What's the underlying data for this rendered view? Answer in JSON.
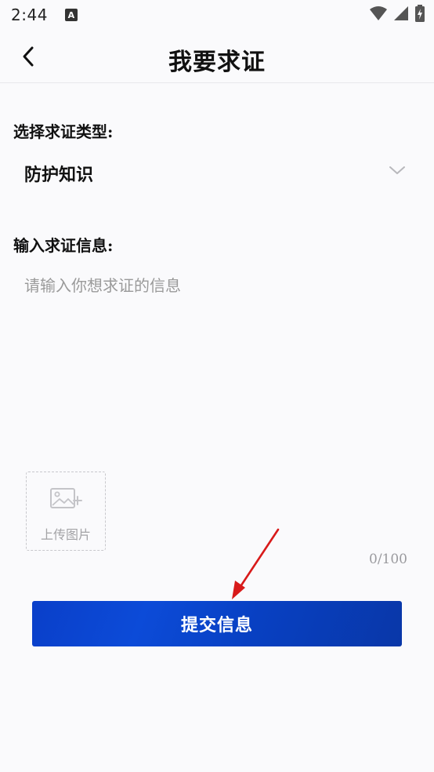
{
  "status_bar": {
    "time": "2:44",
    "notification_icon_letter": "A",
    "icons": [
      "a-notification-icon",
      "wifi-icon",
      "signal-icon",
      "battery-charging-icon"
    ]
  },
  "header": {
    "title": "我要求证",
    "back_icon": "chevron-left-icon"
  },
  "form": {
    "type_label": "选择求证类型:",
    "type_value": "防护知识",
    "info_label": "输入求证信息:",
    "info_placeholder": "请输入你想求证的信息",
    "info_value": "",
    "upload_label": "上传图片",
    "char_count": "0/100",
    "submit_label": "提交信息"
  },
  "colors": {
    "primary": "#0a43cc",
    "annotation_arrow": "#d81a1a",
    "placeholder": "#9a9a9a",
    "background": "#fafafc"
  }
}
